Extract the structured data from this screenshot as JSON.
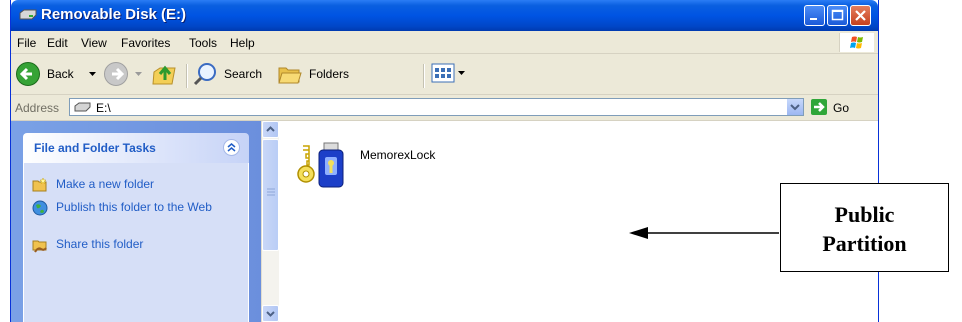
{
  "window": {
    "title": "Removable Disk (E:)",
    "title_icon": "drive-icon",
    "controls": [
      "minimize",
      "maximize",
      "close"
    ]
  },
  "menu": {
    "items": [
      "File",
      "Edit",
      "View",
      "Favorites",
      "Tools",
      "Help"
    ]
  },
  "toolbar": {
    "back_label": "Back",
    "search_label": "Search",
    "folders_label": "Folders"
  },
  "address": {
    "label": "Address",
    "value": "E:\\",
    "go_label": "Go"
  },
  "task_panel": {
    "title": "File and Folder Tasks",
    "tasks": [
      {
        "label": "Make a new folder",
        "icon": "new-folder-icon"
      },
      {
        "label": "Publish this folder to the Web",
        "icon": "globe-icon"
      },
      {
        "label": "Share this folder",
        "icon": "share-folder-icon"
      }
    ]
  },
  "files": [
    {
      "name": "MemorexLock",
      "icon": "key-lock-icon"
    }
  ],
  "callout": {
    "text": "Public\nPartition"
  },
  "colors": {
    "titlebar": "#0054e3",
    "chrome": "#ece9d8",
    "task_link": "#215dc6",
    "task_pane": "#6b8fdd"
  }
}
